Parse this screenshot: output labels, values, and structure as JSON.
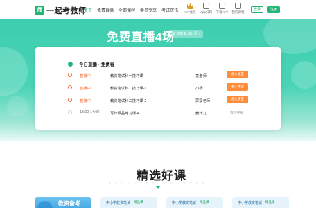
{
  "header": {
    "logo_mark": "师",
    "logo_text": "一起考教师",
    "nav": [
      "首页",
      "免费直播",
      "全部课程",
      "会员专享",
      "考试资讯"
    ],
    "active_nav_index": 0,
    "icons": [
      {
        "label": "VIP会员",
        "icon": "crown-icon"
      },
      {
        "label": "App扫码",
        "icon": "app-icon"
      },
      {
        "label": "下载APP",
        "icon": "download-icon"
      },
      {
        "label": "我的课程",
        "icon": "course-icon"
      }
    ],
    "login_label": "登录",
    "register_label": "注册"
  },
  "banner": {
    "title": "免费直播4场",
    "tag": "考证笔试 幼儿园 ›"
  },
  "live": {
    "heading": "今日直播 · 免费看",
    "rows": [
      {
        "status": "直播中",
        "course": "教资笔试科一技巧课",
        "teacher": "亮老师",
        "action": "进入课堂"
      },
      {
        "status": "直播中",
        "course": "教资笔试科二技巧课-1",
        "teacher": "小杨",
        "action": "进入课堂"
      },
      {
        "status": "直播中",
        "course": "教资笔试科二技巧课-2",
        "teacher": "蒙蒙老师",
        "action": "进入课堂"
      },
      {
        "status": "13:00-14:00",
        "course": "写作评品练习课-4",
        "teacher": "姜汁儿",
        "action": "等待开播"
      }
    ]
  },
  "featured": {
    "title": "精选好课",
    "subtitle": "SELECTED COURSES",
    "cards": [
      {
        "caption": "教资备考"
      },
      {
        "caption": "中小学教资笔试",
        "tag": "精品课"
      },
      {
        "caption": "中小学教资笔试",
        "tag": "精品课"
      },
      {
        "caption": "中小学教资笔试",
        "tag": "精品课"
      }
    ]
  },
  "colors": {
    "brand": "#22b573",
    "accent": "#ff8c3b",
    "banner": "#3ecdb0"
  }
}
